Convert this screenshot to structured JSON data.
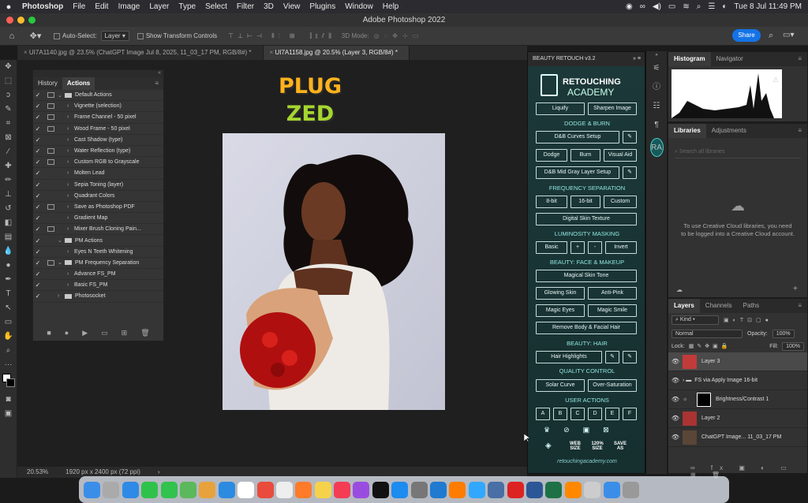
{
  "menubar": {
    "app": "Photoshop",
    "items": [
      "File",
      "Edit",
      "Image",
      "Layer",
      "Type",
      "Select",
      "Filter",
      "3D",
      "View",
      "Plugins",
      "Window",
      "Help"
    ],
    "clock": "Tue 8 Jul  11:49 PM"
  },
  "window_title": "Adobe Photoshop 2022",
  "options": {
    "auto_select_label": "Auto-Select:",
    "auto_select_value": "Layer",
    "transform_label": "Show Transform Controls",
    "mode_3d": "3D Mode:",
    "share_label": "Share"
  },
  "doc_tabs": [
    {
      "label": "UI7A1140.jpg @ 23.5% (ChatGPT Image Jul 8, 2025, 11_03_17 PM, RGB/8#) *"
    },
    {
      "label": "UI7A1158.jpg @ 20.5% (Layer 3, RGB/8#) *"
    }
  ],
  "status": {
    "zoom": "20.53%",
    "size": "1920 px x 2400 px (72 ppi)",
    "arrow": "›"
  },
  "actions_panel": {
    "tabs": [
      "History",
      "Actions"
    ],
    "rows": [
      {
        "label": "Default Actions",
        "kind": "folder",
        "box": true,
        "open": true
      },
      {
        "label": "Vignette (selection)",
        "kind": "action",
        "box": true
      },
      {
        "label": "Frame Channel - 50 pixel",
        "kind": "action",
        "box": true
      },
      {
        "label": "Wood Frame - 50 pixel",
        "kind": "action",
        "box": true
      },
      {
        "label": "Cast Shadow (type)",
        "kind": "action",
        "box": false
      },
      {
        "label": "Water Reflection (type)",
        "kind": "action",
        "box": true
      },
      {
        "label": "Custom RGB to Grayscale",
        "kind": "action",
        "box": true
      },
      {
        "label": "Molten Lead",
        "kind": "action",
        "box": false
      },
      {
        "label": "Sepia Toning (layer)",
        "kind": "action",
        "box": false
      },
      {
        "label": "Quadrant Colors",
        "kind": "action",
        "box": false
      },
      {
        "label": "Save as Photoshop PDF",
        "kind": "action",
        "box": true
      },
      {
        "label": "Gradient Map",
        "kind": "action",
        "box": false
      },
      {
        "label": "Mixer Brush Cloning Pain...",
        "kind": "action",
        "box": true
      },
      {
        "label": "PM Actions",
        "kind": "folder",
        "box": false,
        "open": true
      },
      {
        "label": "Eyes N Teeth Whitening",
        "kind": "action",
        "box": false
      },
      {
        "label": "PM Frequency Separation",
        "kind": "folder",
        "box": true,
        "open": true
      },
      {
        "label": "Advance FS_PM",
        "kind": "action",
        "box": false
      },
      {
        "label": "Basic FS_PM",
        "kind": "action",
        "box": false
      },
      {
        "label": "Photosocket",
        "kind": "folder",
        "box": false,
        "open": false
      }
    ]
  },
  "logo": {
    "line1": "PLUG",
    "line2": "ZED"
  },
  "beauty": {
    "title": "BEAUTY RETOUCH v3.2",
    "brand1": "RETOUCHING",
    "brand2": "ACADEMY",
    "liquify": "Liquify",
    "sharpen": "Sharpen Image",
    "s_dodge": "DODGE & BURN",
    "curves": "D&B Curves Setup",
    "dodge": "Dodge",
    "burn": "Burn",
    "visual": "Visual Aid",
    "midgray": "D&B Mid Gray Layer Setup",
    "s_freq": "FREQUENCY SEPARATION",
    "b8": "8-bit",
    "b16": "16-bit",
    "custom": "Custom",
    "texture": "Digital Skin Texture",
    "s_lum": "LUMINOSITY MASKING",
    "basic": "Basic",
    "plus": "+",
    "minus": "-",
    "invert": "Invert",
    "s_face": "BEAUTY: FACE & MAKEUP",
    "magicskin": "Magical Skin Tone",
    "glowing": "Glowing Skin",
    "antipink": "Anti-Pink",
    "magiceyes": "Magic Eyes",
    "magicsmile": "Magic Smile",
    "remove": "Remove Body & Facial Hair",
    "s_hair": "BEAUTY: HAIR",
    "hairhl": "Hair Highlights",
    "s_qc": "QUALITY CONTROL",
    "solar": "Solar Curve",
    "oversat": "Over-Saturation",
    "s_user": "USER ACTIONS",
    "user": [
      "A",
      "B",
      "C",
      "D",
      "E",
      "F"
    ],
    "web": "WEB SIZE",
    "size120": "120% SIZE",
    "saveas": "SAVE AS",
    "url": "retouchingacademy.com"
  },
  "histogram": {
    "tabs": [
      "Histogram",
      "Navigator"
    ]
  },
  "libraries": {
    "tabs": [
      "Libraries",
      "Adjustments"
    ],
    "search_placeholder": "Search all libraries",
    "message": "To use Creative Cloud libraries, you need to be logged into a Creative Cloud account."
  },
  "layers": {
    "tabs": [
      "Layers",
      "Channels",
      "Paths"
    ],
    "filter": "Kind",
    "blend": "Normal",
    "opacity_label": "Opacity:",
    "opacity": "100%",
    "lock_label": "Lock:",
    "fill_label": "Fill:",
    "fill": "100%",
    "items": [
      {
        "name": "Layer 3",
        "selected": true
      },
      {
        "name": "FS via Apply Image 16-bit",
        "group": true
      },
      {
        "name": "Brightness/Contrast 1",
        "adjust": true
      },
      {
        "name": "Layer 2"
      },
      {
        "name": "ChatGPT Image... 11_03_17 PM"
      }
    ]
  },
  "dock": [
    "Finder",
    "Launchpad",
    "Mail",
    "FaceTime",
    "Messages",
    "Maps",
    "Photos",
    "Safari",
    "Calendar",
    "Chrome",
    "Reminders",
    "Firefox",
    "Notes",
    "Music",
    "Podcasts",
    "TV",
    "App Store",
    "Settings",
    "VS Code",
    "Illustrator",
    "Photoshop",
    "Mail2",
    "Opera",
    "Word",
    "Excel",
    "VLC",
    "Preview",
    "Finder2",
    "Trash"
  ],
  "colors": {
    "accent": "#1473e6",
    "beauty_panel": "#1c3838",
    "beauty_text": "#9fe0e0"
  }
}
